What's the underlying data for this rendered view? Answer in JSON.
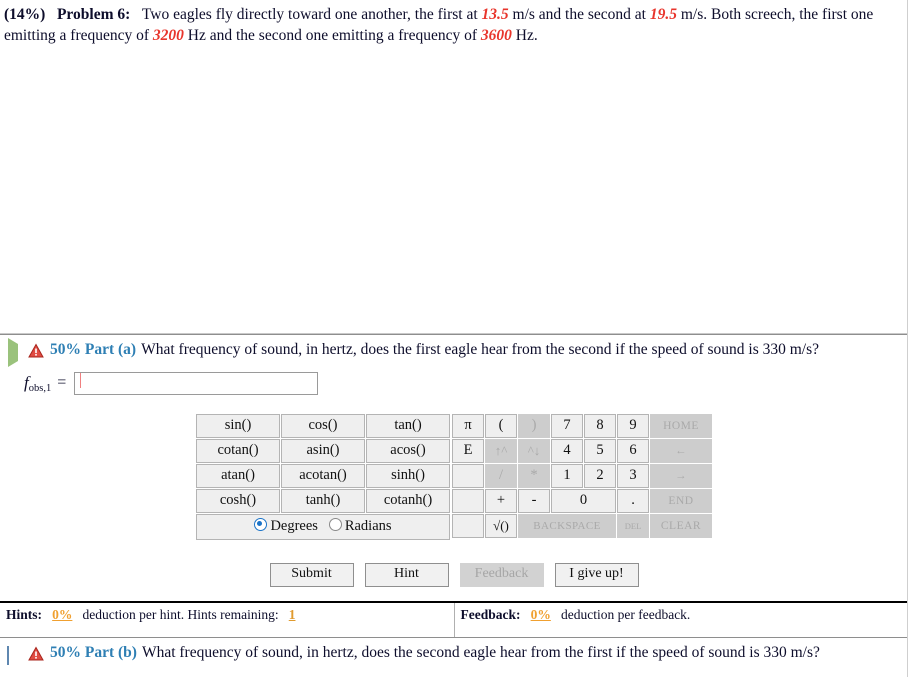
{
  "problem": {
    "percent": "(14%)",
    "label": "Problem 6:",
    "text_1": "Two eagles fly directly toward one another, the first at ",
    "v1": "13.5",
    "text_2": " m/s and the second at ",
    "v2": "19.5",
    "text_3": " m/s. Both screech, the first one emitting a frequency of ",
    "f1": "3200",
    "text_4": " Hz and the second one emitting a frequency of ",
    "f2": "3600",
    "text_5": " Hz."
  },
  "part_a": {
    "toggle_icon": "triangle-right-icon",
    "warning_icon": "warning-triangle-icon",
    "percent": "50% Part (a)",
    "question": "What frequency of sound, in hertz, does the first eagle hear from the second if the speed of sound is 330 m/s?",
    "answer_var": "f",
    "answer_sub": "obs,1",
    "equals": "=",
    "answer_value": "",
    "answer_placeholder": ""
  },
  "part_b": {
    "toggle_icon": "square-collapsed-icon",
    "warning_icon": "warning-triangle-icon",
    "percent": "50% Part (b)",
    "question": "What frequency of sound, in hertz, does the second eagle hear from the first if the speed of sound is 330 m/s?"
  },
  "keypad": {
    "functions": [
      [
        "sin()",
        "cos()",
        "tan()"
      ],
      [
        "cotan()",
        "asin()",
        "acos()"
      ],
      [
        "atan()",
        "acotan()",
        "sinh()"
      ],
      [
        "cosh()",
        "tanh()",
        "cotanh()"
      ]
    ],
    "angle_mode": {
      "degrees_label": "Degrees",
      "radians_label": "Radians",
      "selected": "Degrees"
    },
    "rows": [
      [
        {
          "label": "π",
          "disabled": false,
          "w": "n"
        },
        {
          "label": "(",
          "disabled": false,
          "w": "n"
        },
        {
          "label": ")",
          "disabled": true,
          "w": "n"
        },
        {
          "label": "7",
          "disabled": false,
          "w": "n"
        },
        {
          "label": "8",
          "disabled": false,
          "w": "n"
        },
        {
          "label": "9",
          "disabled": false,
          "w": "n"
        },
        {
          "label": "HOME",
          "disabled": true,
          "w": "home"
        }
      ],
      [
        {
          "label": "E",
          "disabled": false,
          "w": "n"
        },
        {
          "label": "↑^",
          "disabled": true,
          "w": "n"
        },
        {
          "label": "^↓",
          "disabled": true,
          "w": "n"
        },
        {
          "label": "4",
          "disabled": false,
          "w": "n"
        },
        {
          "label": "5",
          "disabled": false,
          "w": "n"
        },
        {
          "label": "6",
          "disabled": false,
          "w": "n"
        },
        {
          "label": "←",
          "disabled": true,
          "w": "home"
        }
      ],
      [
        {
          "label": "",
          "disabled": false,
          "w": "n"
        },
        {
          "label": "/",
          "disabled": true,
          "w": "n"
        },
        {
          "label": "*",
          "disabled": true,
          "w": "n"
        },
        {
          "label": "1",
          "disabled": false,
          "w": "n"
        },
        {
          "label": "2",
          "disabled": false,
          "w": "n"
        },
        {
          "label": "3",
          "disabled": false,
          "w": "n"
        },
        {
          "label": "→",
          "disabled": true,
          "w": "home"
        }
      ],
      [
        {
          "label": "",
          "disabled": false,
          "w": "n"
        },
        {
          "label": "+",
          "disabled": false,
          "w": "n"
        },
        {
          "label": "-",
          "disabled": false,
          "w": "n"
        },
        {
          "label": "0",
          "disabled": false,
          "w": "wide"
        },
        {
          "label": ".",
          "disabled": false,
          "w": "n"
        },
        {
          "label": "END",
          "disabled": true,
          "w": "home"
        }
      ],
      [
        {
          "label": "",
          "disabled": false,
          "w": "n"
        },
        {
          "label": "√()",
          "disabled": false,
          "w": "n"
        },
        {
          "label": "BACKSPACE",
          "disabled": true,
          "w": "bs"
        },
        {
          "label": "DEL",
          "disabled": true,
          "w": "del"
        },
        {
          "label": "CLEAR",
          "disabled": true,
          "w": "home"
        }
      ]
    ]
  },
  "actions": {
    "submit": "Submit",
    "hint": "Hint",
    "feedback": "Feedback",
    "give_up": "I give up!"
  },
  "footer": {
    "hints_label": "Hints:",
    "hints_pct": "0%",
    "hints_text": "deduction per hint. Hints remaining:",
    "hints_remaining": "1",
    "feedback_label": "Feedback:",
    "feedback_pct": "0%",
    "feedback_text": "deduction per feedback."
  },
  "colors": {
    "accent_blue": "#2e7fb4",
    "value_red": "#e8352c",
    "deduction_orange": "#f0a030"
  }
}
